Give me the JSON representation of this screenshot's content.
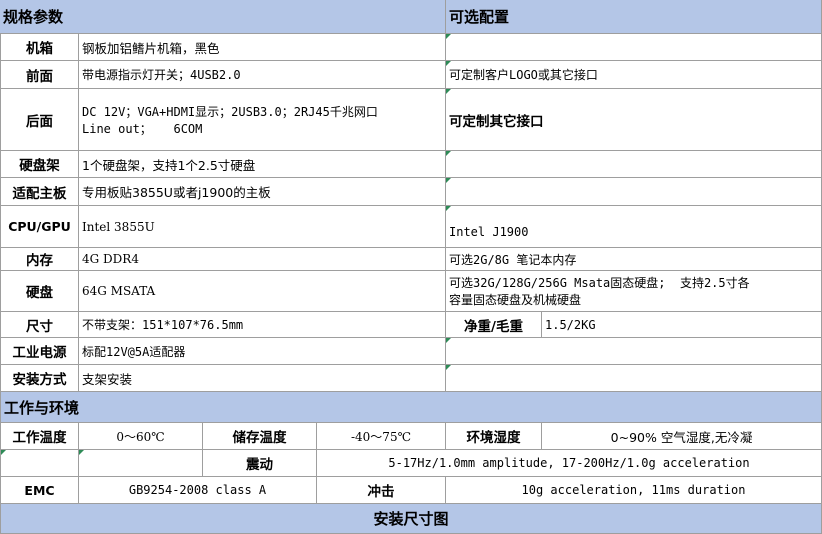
{
  "headers": {
    "specs": "规格参数",
    "options": "可选配置",
    "environment": "工作与环境",
    "install_size": "安装尺寸图"
  },
  "specs": {
    "chassis": {
      "label": "机箱",
      "value": "钢板加铝鳍片机箱，黑色",
      "option": ""
    },
    "front": {
      "label": "前面",
      "value": "带电源指示灯开关；4USB2.0",
      "option": "可定制客户LOGO或其它接口"
    },
    "rear": {
      "label": "后面",
      "value_line1": "DC 12V；VGA+HDMI显示；2USB3.0；2RJ45千兆网口",
      "value_line2": "Line out；   6COM",
      "option": "可定制其它接口"
    },
    "hdd_bay": {
      "label": "硬盘架",
      "value": "1个硬盘架，支持1个2.5寸硬盘",
      "option": ""
    },
    "board": {
      "label": "适配主板",
      "value": "专用板贴3855U或者j1900的主板",
      "option": ""
    },
    "cpu": {
      "label": "CPU/GPU",
      "value": "Intel 3855U",
      "option": "Intel J1900"
    },
    "memory": {
      "label": "内存",
      "value": "4G DDR4",
      "option": "可选2G/8G 笔记本内存"
    },
    "disk": {
      "label": "硬盘",
      "value": "64G MSATA",
      "option_line1": "可选32G/128G/256G Msata固态硬盘;  支持2.5寸各",
      "option_line2": "容量固态硬盘及机械硬盘"
    },
    "size": {
      "label": "尺寸",
      "value": "不带支架：151*107*76.5mm",
      "weight_label": "净重/毛重",
      "weight_value": "1.5/2KG"
    },
    "power": {
      "label": "工业电源",
      "value": "标配12V@5A适配器",
      "option": ""
    },
    "mount": {
      "label": "安装方式",
      "value": "支架安装",
      "option": ""
    }
  },
  "environment": {
    "work_temp_label": "工作温度",
    "work_temp_value": "0～60℃",
    "store_temp_label": "储存温度",
    "store_temp_value": "-40～75℃",
    "humidity_label": "环境湿度",
    "humidity_value": "0~90% 空气湿度,无冷凝",
    "vibration_label": "震动",
    "vibration_value": "5-17Hz/1.0mm amplitude, 17-200Hz/1.0g acceleration",
    "emc_label": "EMC",
    "emc_value": "GB9254-2008 class A",
    "shock_label": "冲击",
    "shock_value": "10g acceleration, 11ms duration"
  }
}
